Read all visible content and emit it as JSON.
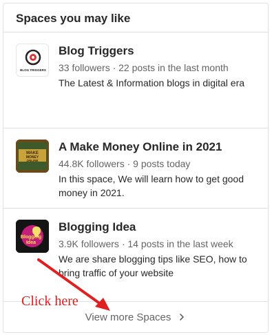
{
  "panel": {
    "title": "Spaces you may like",
    "view_more_label": "View more Spaces"
  },
  "spaces": [
    {
      "name": "Blog Triggers",
      "meta": "33 followers · 22 posts in the last month",
      "description": "The Latest & Information blogs in digital era",
      "thumb_text": "BLOG TRIGGERS",
      "icon": "blog-triggers-logo"
    },
    {
      "name": "A Make Money Online in 2021",
      "meta": "44.8K followers · 9 posts today",
      "description": "In this space, We will learn how to get good money in 2021.",
      "thumb_text": "MAKE MONEY ONLINE",
      "icon": "make-money-online-logo"
    },
    {
      "name": "Blogging Idea",
      "meta": "3.9K followers · 14 posts in the last week",
      "description": "We are share blogging tips like SEO, how to bring traffic of your website",
      "thumb_text": "Blogging Idea",
      "icon": "blogging-idea-logo"
    }
  ],
  "annotation": {
    "text": "Click here",
    "color": "#d92020"
  }
}
